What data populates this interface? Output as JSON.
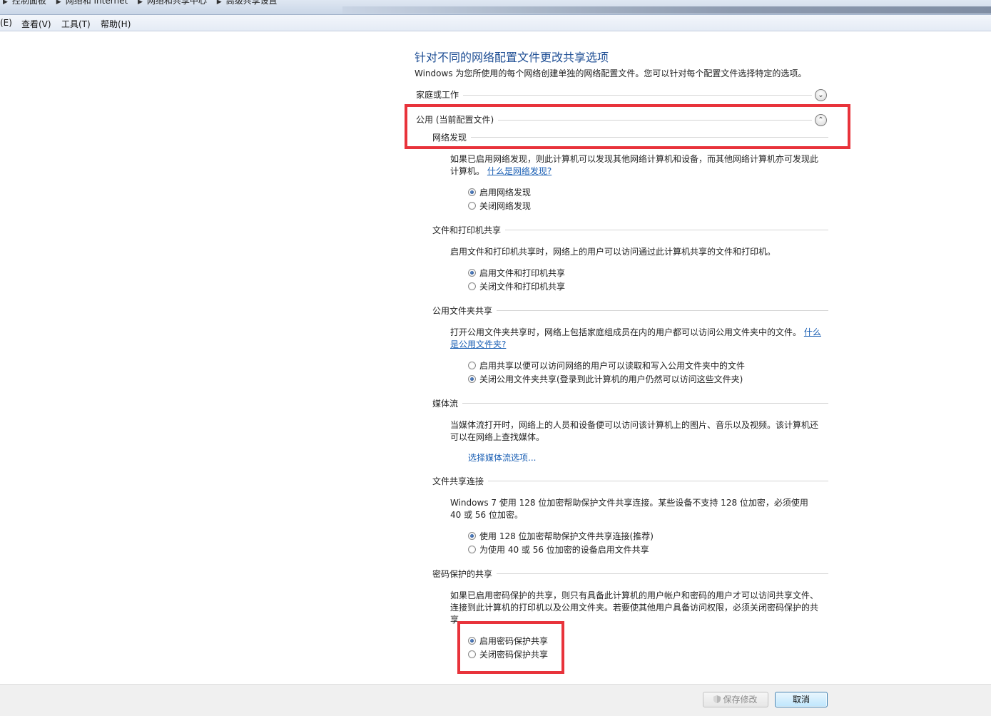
{
  "breadcrumb": [
    "控制面板",
    "网络和 Internet",
    "网络和共享中心",
    "高级共享设置"
  ],
  "menu": [
    "(E)",
    "查看(V)",
    "工具(T)",
    "帮助(H)"
  ],
  "page": {
    "title": "针对不同的网络配置文件更改共享选项",
    "description": "Windows 为您所使用的每个网络创建单独的网络配置文件。您可以针对每个配置文件选择特定的选项。"
  },
  "profiles": {
    "home_work": "家庭或工作",
    "public": "公用 (当前配置文件)"
  },
  "sections": {
    "network_discovery": {
      "title": "网络发现",
      "text": "如果已启用网络发现，则此计算机可以发现其他网络计算机和设备，而其他网络计算机亦可发现此计算机。",
      "link": "什么是网络发现?",
      "options": [
        "启用网络发现",
        "关闭网络发现"
      ],
      "selected": 0
    },
    "file_printer": {
      "title": "文件和打印机共享",
      "text": "启用文件和打印机共享时，网络上的用户可以访问通过此计算机共享的文件和打印机。",
      "options": [
        "启用文件和打印机共享",
        "关闭文件和打印机共享"
      ],
      "selected": 0
    },
    "public_folder": {
      "title": "公用文件夹共享",
      "text": "打开公用文件夹共享时，网络上包括家庭组成员在内的用户都可以访问公用文件夹中的文件。",
      "link": "什么是公用文件夹?",
      "options": [
        "启用共享以便可以访问网络的用户可以读取和写入公用文件夹中的文件",
        "关闭公用文件夹共享(登录到此计算机的用户仍然可以访问这些文件夹)"
      ],
      "selected": 1
    },
    "media": {
      "title": "媒体流",
      "text": "当媒体流打开时，网络上的人员和设备便可以访问该计算机上的图片、音乐以及视频。该计算机还可以在网络上查找媒体。",
      "link": "选择媒体流选项..."
    },
    "file_sharing_conn": {
      "title": "文件共享连接",
      "text": "Windows 7 使用 128 位加密帮助保护文件共享连接。某些设备不支持 128 位加密，必须使用 40 或 56 位加密。",
      "options": [
        "使用 128 位加密帮助保护文件共享连接(推荐)",
        "为使用 40 或 56 位加密的设备启用文件共享"
      ],
      "selected": 0
    },
    "password": {
      "title": "密码保护的共享",
      "text": "如果已启用密码保护的共享，则只有具备此计算机的用户帐户和密码的用户才可以访问共享文件、连接到此计算机的打印机以及公用文件夹。若要使其他用户具备访问权限，必须关闭密码保护的共享",
      "options": [
        "启用密码保护共享",
        "关闭密码保护共享"
      ],
      "selected": 0
    }
  },
  "buttons": {
    "save": "保存修改",
    "cancel": "取消"
  },
  "colors": {
    "highlight": "#e8333b",
    "title": "#1e4e94",
    "link": "#1a5fb4"
  }
}
